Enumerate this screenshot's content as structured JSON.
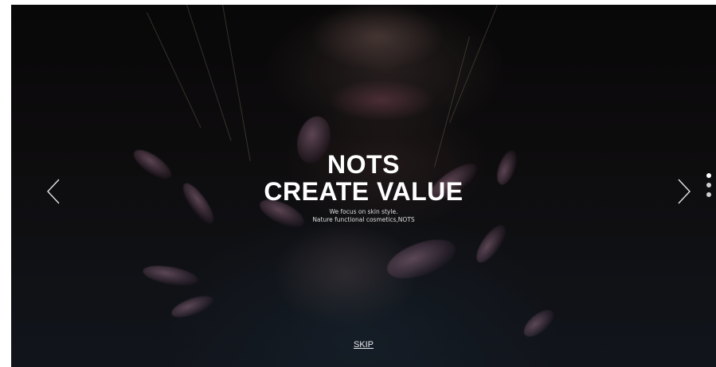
{
  "hero": {
    "title_line1": "NOTS",
    "title_line2": "CREATE VALUE",
    "subtitle_line1": "We focus on skin style.",
    "subtitle_line2": "Nature functional cosmetics,NOTS"
  },
  "controls": {
    "prev_icon": "chevron-left-icon",
    "next_icon": "chevron-right-icon",
    "skip_label": "SKIP"
  },
  "pagination": {
    "count": 3,
    "active_index": 0
  },
  "colors": {
    "text": "#ffffff",
    "background": "#0d0b0c",
    "dot": "#cfcfcf"
  }
}
